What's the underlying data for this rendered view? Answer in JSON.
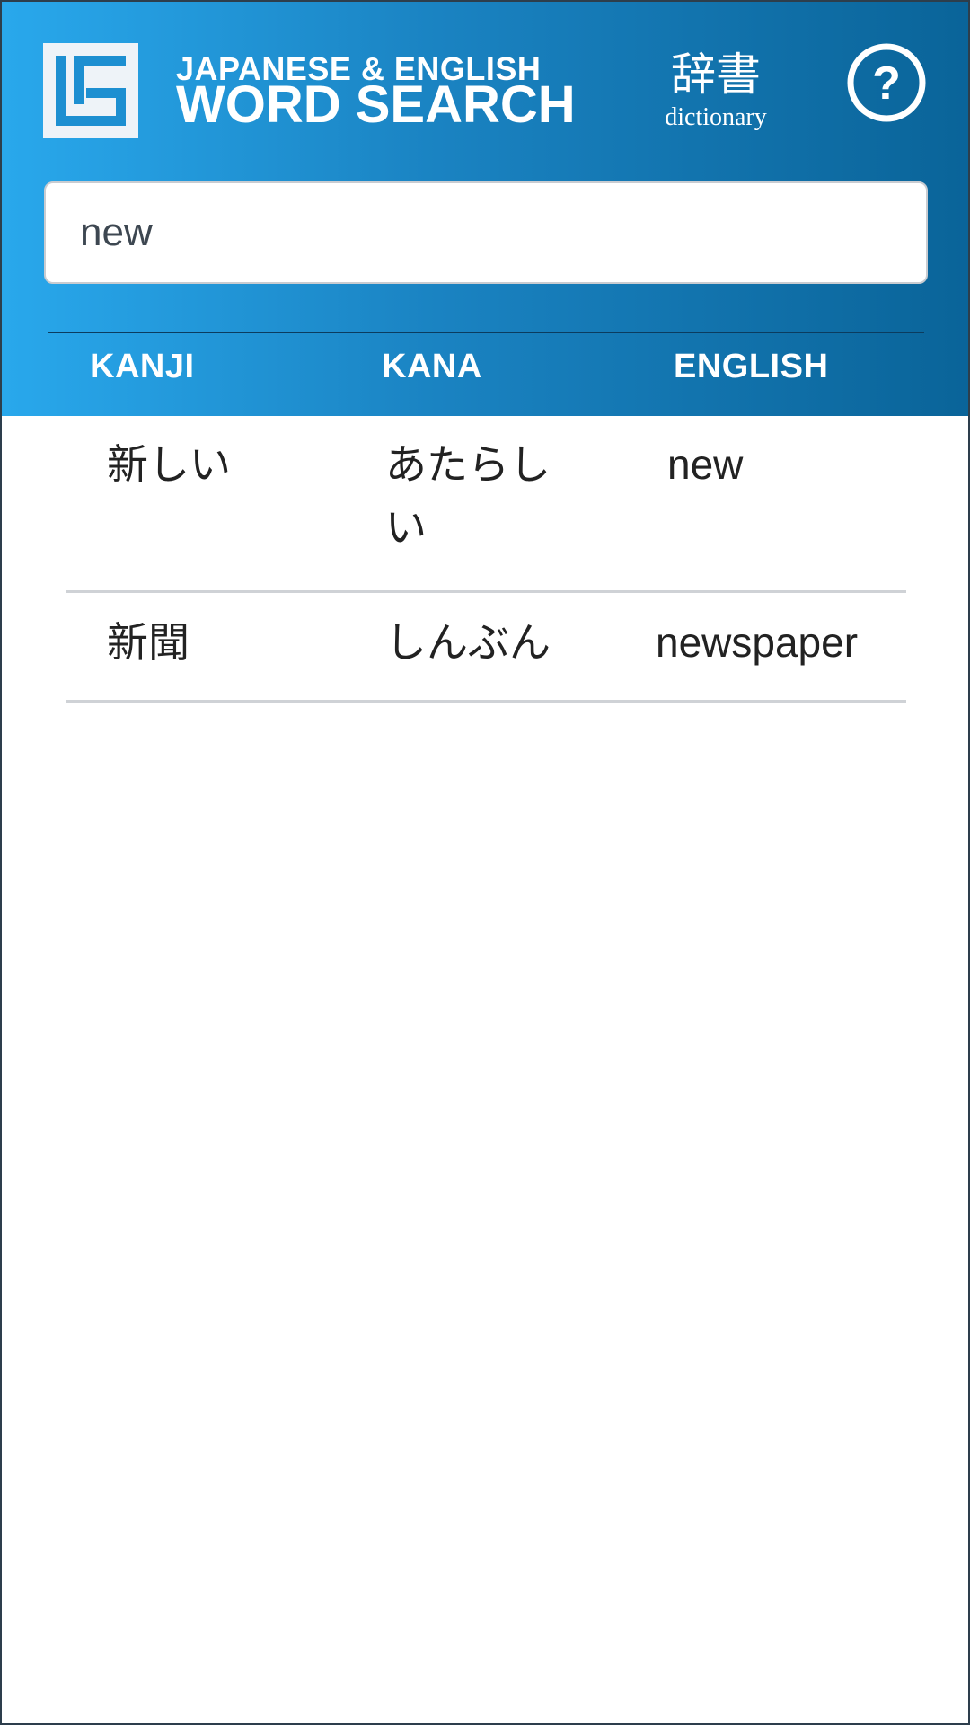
{
  "app": {
    "title_line1": "JAPANESE & ENGLISH",
    "title_line2": "WORD SEARCH",
    "dictionary_kanji": "辞書",
    "dictionary_label": "dictionary",
    "help_symbol": "?",
    "logo_icon": "word-search-logo-icon",
    "help_icon": "question-circle-icon"
  },
  "search": {
    "value": "new",
    "placeholder": ""
  },
  "columns": [
    "KANJI",
    "KANA",
    "ENGLISH"
  ],
  "results": [
    {
      "kanji": "新しい",
      "kana": "あたらしい",
      "english": "new"
    },
    {
      "kanji": "新聞",
      "kana": "しんぶん",
      "english": "newspaper"
    }
  ],
  "colors": {
    "header_gradient_start": "#29a8ec",
    "header_gradient_end": "#0a6499",
    "text_dark": "#222222",
    "divider": "#cfd2d6"
  }
}
